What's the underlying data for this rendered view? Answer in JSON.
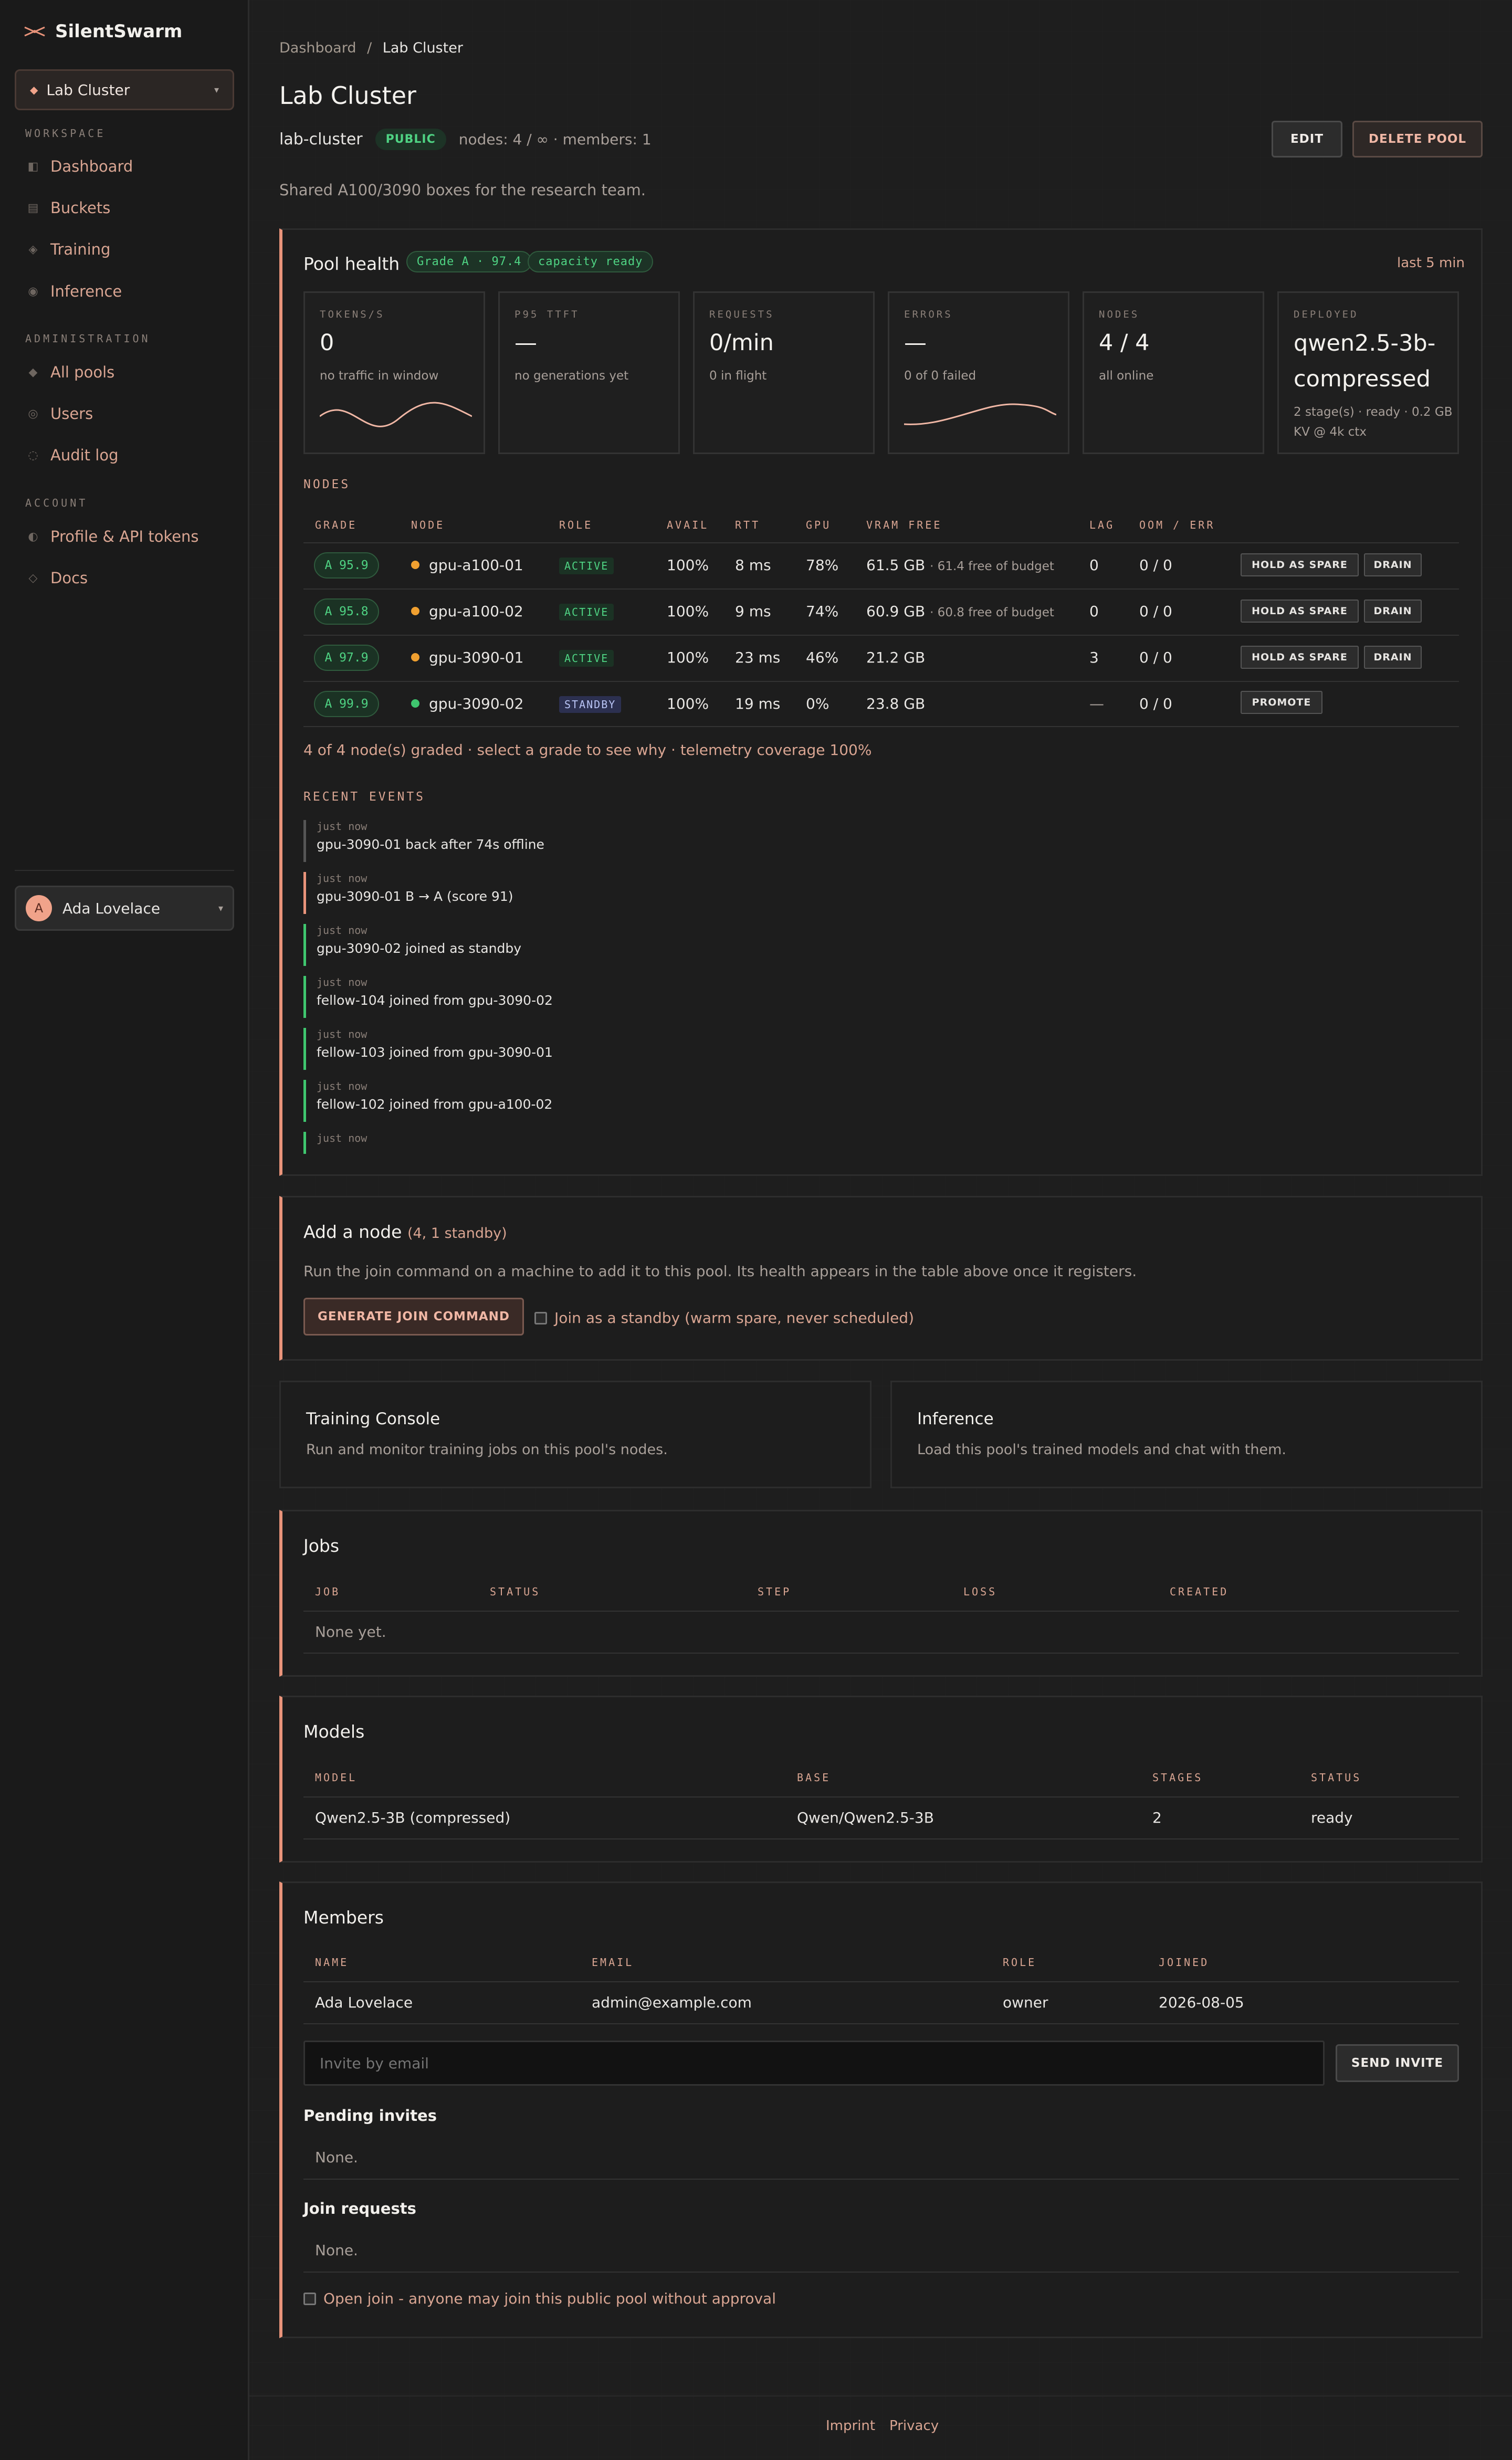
{
  "brand": {
    "name": "SilentSwarm"
  },
  "pool_selector": {
    "label": "Lab Cluster"
  },
  "sidebar": {
    "workspace_label": "WORKSPACE",
    "workspace": [
      {
        "label": "Dashboard",
        "icon": "dashboard-icon"
      },
      {
        "label": "Buckets",
        "icon": "bucket-icon"
      },
      {
        "label": "Training",
        "icon": "training-icon"
      },
      {
        "label": "Inference",
        "icon": "inference-icon"
      }
    ],
    "admin_label": "ADMINISTRATION",
    "admin": [
      {
        "label": "All pools",
        "icon": "pools-icon"
      },
      {
        "label": "Users",
        "icon": "users-icon"
      },
      {
        "label": "Audit log",
        "icon": "audit-icon"
      }
    ],
    "account_label": "ACCOUNT",
    "account": [
      {
        "label": "Profile & API tokens",
        "icon": "profile-icon"
      },
      {
        "label": "Docs",
        "icon": "docs-icon"
      }
    ],
    "user": {
      "initial": "A",
      "name": "Ada Lovelace"
    }
  },
  "breadcrumb": {
    "root": "Dashboard",
    "sep": "/",
    "current": "Lab Cluster"
  },
  "pool": {
    "title": "Lab Cluster",
    "slug": "lab-cluster",
    "visibility": "PUBLIC",
    "summary": "nodes: 4 / ∞ · members: 1",
    "description": "Shared A100/3090 boxes for the research team.",
    "edit_label": "EDIT",
    "delete_label": "DELETE POOL"
  },
  "health": {
    "title": "Pool health",
    "grade_badge": "Grade A · 97.4",
    "capacity_badge": "capacity ready",
    "window": "last 5 min",
    "stats": [
      {
        "label": "TOKENS/S",
        "value": "0",
        "sub": "no traffic in window"
      },
      {
        "label": "P95 TTFT",
        "value": "—",
        "sub": "no generations yet"
      },
      {
        "label": "REQUESTS",
        "value": "0/min",
        "sub": "0 in flight"
      },
      {
        "label": "ERRORS",
        "value": "—",
        "sub": "0 of 0 failed"
      },
      {
        "label": "NODES",
        "value": "4 / 4",
        "sub": "all online"
      },
      {
        "label": "DEPLOYED",
        "value": "qwen2.5-3b-compressed",
        "value_line1": "qwen2.5-3b-",
        "value_line2": "compressed",
        "sub": "2 stage(s) · ready · 0.2 GB KV @ 4k ctx",
        "sub_line1": "2 stage(s) · ready · 0.2 GB",
        "sub_line2": "KV @ 4k ctx"
      }
    ]
  },
  "nodes": {
    "section_label": "NODES",
    "headers": [
      "GRADE",
      "NODE",
      "ROLE",
      "AVAIL",
      "RTT",
      "GPU",
      "VRAM FREE",
      "LAG",
      "OOM / ERR"
    ],
    "rows": [
      {
        "grade": "A 95.9",
        "status_color": "#f0a030",
        "node": "gpu-a100-01",
        "role": "ACTIVE",
        "avail": "100%",
        "rtt": "8 ms",
        "gpu": "78%",
        "vram": "61.5 GB",
        "vram_note": "· 61.4 free of budget",
        "lag": "0",
        "oom": "0 / 0",
        "actions": [
          "HOLD AS SPARE",
          "DRAIN"
        ]
      },
      {
        "grade": "A 95.8",
        "status_color": "#f0a030",
        "node": "gpu-a100-02",
        "role": "ACTIVE",
        "avail": "100%",
        "rtt": "9 ms",
        "gpu": "74%",
        "vram": "60.9 GB",
        "vram_note": "· 60.8 free of budget",
        "lag": "0",
        "oom": "0 / 0",
        "actions": [
          "HOLD AS SPARE",
          "DRAIN"
        ]
      },
      {
        "grade": "A 97.9",
        "status_color": "#f0a030",
        "node": "gpu-3090-01",
        "role": "ACTIVE",
        "avail": "100%",
        "rtt": "23 ms",
        "gpu": "46%",
        "vram": "21.2 GB",
        "vram_note": "",
        "lag": "3",
        "oom": "0 / 0",
        "actions": [
          "HOLD AS SPARE",
          "DRAIN"
        ]
      },
      {
        "grade": "A 99.9",
        "status_color": "#3fc66f",
        "node": "gpu-3090-02",
        "role": "STANDBY",
        "avail": "100%",
        "rtt": "19 ms",
        "gpu": "0%",
        "vram": "23.8 GB",
        "vram_note": "",
        "lag": "—",
        "oom": "0 / 0",
        "actions": [
          "PROMOTE"
        ]
      }
    ],
    "footnote": "4 of 4 node(s) graded · select a grade to see why · telemetry coverage 100%"
  },
  "events": {
    "section_label": "RECENT EVENTS",
    "items": [
      {
        "time": "just now",
        "text": "gpu-3090-01 back after 74s offline",
        "color": "#555555"
      },
      {
        "time": "just now",
        "text": "gpu-3090-01 B → A (score 91)",
        "color": "#e8937a"
      },
      {
        "time": "just now",
        "text": "gpu-3090-02 joined as standby",
        "color": "#3fc66f"
      },
      {
        "time": "just now",
        "text": "fellow-104 joined from gpu-3090-02",
        "color": "#3fc66f"
      },
      {
        "time": "just now",
        "text": "fellow-103 joined from gpu-3090-01",
        "color": "#3fc66f"
      },
      {
        "time": "just now",
        "text": "fellow-102 joined from gpu-a100-02",
        "color": "#3fc66f"
      },
      {
        "time": "just now",
        "text": "",
        "color": "#3fc66f"
      }
    ]
  },
  "add_node": {
    "title": "Add a node",
    "count": "(4, 1 standby)",
    "description": "Run the join command on a machine to add it to this pool. Its health appears in the table above once it registers.",
    "button": "GENERATE JOIN COMMAND",
    "standby_label": "Join as a standby (warm spare, never scheduled)"
  },
  "links": [
    {
      "title": "Training Console",
      "desc": "Run and monitor training jobs on this pool's nodes."
    },
    {
      "title": "Inference",
      "desc": "Load this pool's trained models and chat with them."
    }
  ],
  "jobs": {
    "title": "Jobs",
    "headers": [
      "JOB",
      "STATUS",
      "STEP",
      "LOSS",
      "CREATED"
    ],
    "empty": "None yet."
  },
  "models": {
    "title": "Models",
    "headers": [
      "MODEL",
      "BASE",
      "STAGES",
      "STATUS"
    ],
    "rows": [
      {
        "model": "Qwen2.5-3B (compressed)",
        "base": "Qwen/Qwen2.5-3B",
        "stages": "2",
        "status": "ready"
      }
    ]
  },
  "members": {
    "title": "Members",
    "headers": [
      "NAME",
      "EMAIL",
      "ROLE",
      "JOINED"
    ],
    "rows": [
      {
        "name": "Ada Lovelace",
        "email": "admin@example.com",
        "role": "owner",
        "joined": "2026-08-05"
      }
    ],
    "invite_placeholder": "Invite by email",
    "send_label": "SEND INVITE",
    "pending_title": "Pending invites",
    "pending_empty": "None.",
    "requests_title": "Join requests",
    "requests_empty": "None.",
    "open_join_label": "Open join - anyone may join this public pool without approval"
  },
  "footer": {
    "imprint": "Imprint",
    "privacy": "Privacy"
  },
  "colors": {
    "accent": "#e8937a",
    "success": "#4fd383",
    "warning": "#f0a030"
  }
}
